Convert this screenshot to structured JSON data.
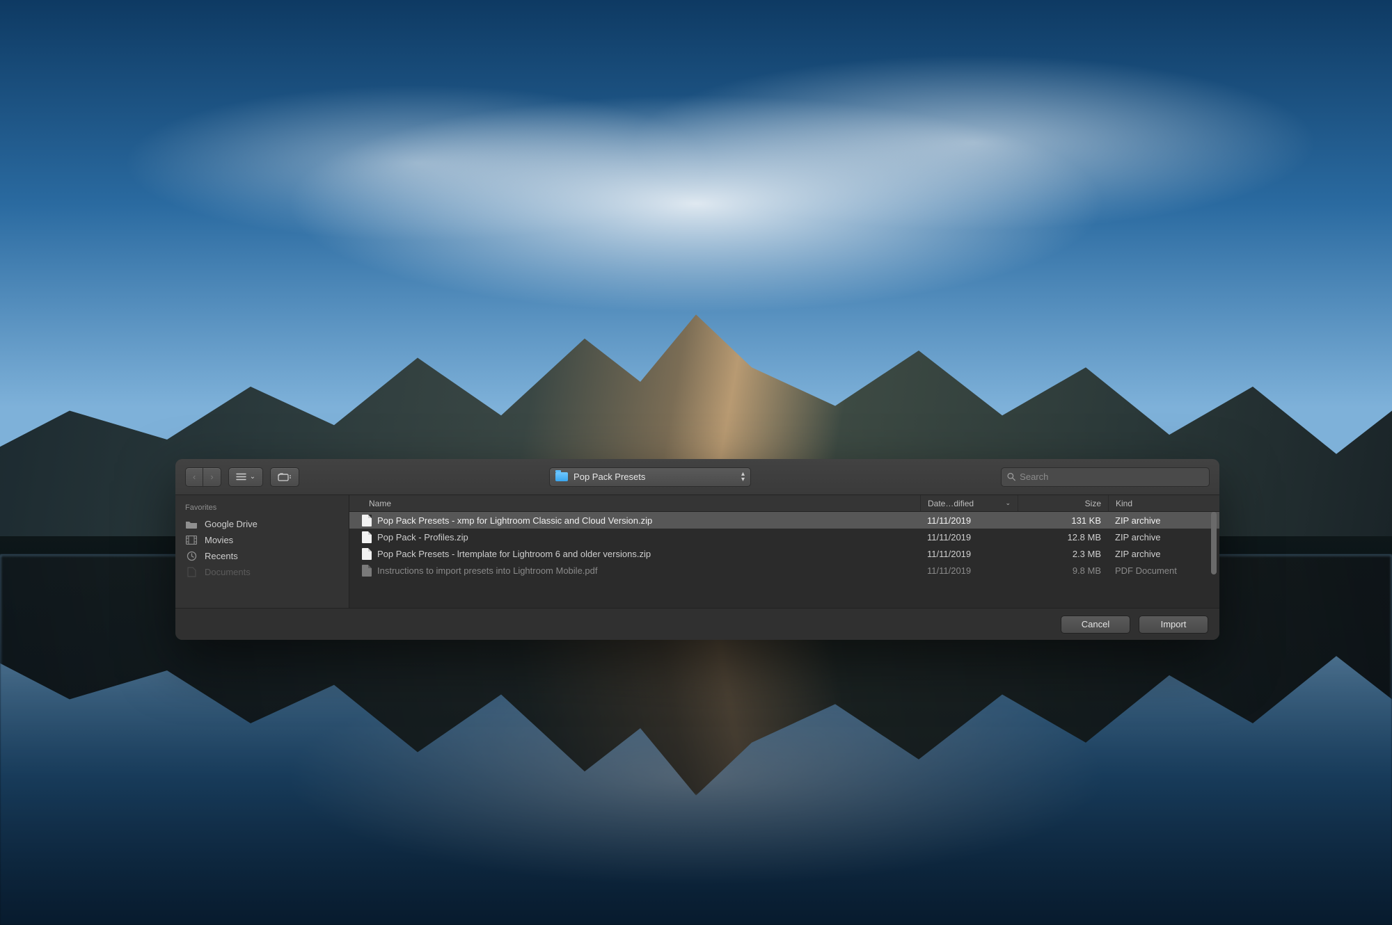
{
  "toolbar": {
    "folder_name": "Pop Pack Presets",
    "search_placeholder": "Search"
  },
  "sidebar": {
    "header": "Favorites",
    "items": [
      {
        "icon": "folder-icon",
        "label": "Google Drive"
      },
      {
        "icon": "film-icon",
        "label": "Movies"
      },
      {
        "icon": "clock-icon",
        "label": "Recents"
      },
      {
        "icon": "document-icon",
        "label": "Documents"
      }
    ]
  },
  "columns": {
    "name": "Name",
    "date": "Date…dified",
    "size": "Size",
    "kind": "Kind"
  },
  "files": [
    {
      "name": "Pop Pack Presets - xmp for Lightroom Classic and Cloud Version.zip",
      "date": "11/11/2019",
      "size": "131 KB",
      "kind": "ZIP archive",
      "selected": true
    },
    {
      "name": "Pop Pack - Profiles.zip",
      "date": "11/11/2019",
      "size": "12.8 MB",
      "kind": "ZIP archive",
      "selected": false
    },
    {
      "name": "Pop Pack Presets - lrtemplate for Lightroom 6 and older versions.zip",
      "date": "11/11/2019",
      "size": "2.3 MB",
      "kind": "ZIP archive",
      "selected": false
    },
    {
      "name": "Instructions to import presets into Lightroom Mobile.pdf",
      "date": "11/11/2019",
      "size": "9.8 MB",
      "kind": "PDF Document",
      "selected": false,
      "dimmed": true
    }
  ],
  "footer": {
    "cancel": "Cancel",
    "import": "Import"
  }
}
